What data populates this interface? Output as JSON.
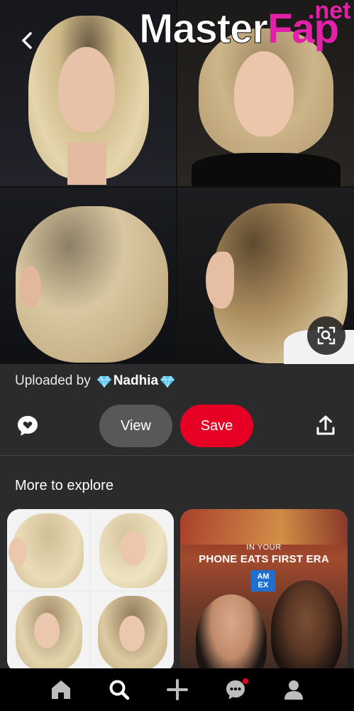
{
  "watermark": {
    "brand_main": "Master",
    "brand_accent": "Fap",
    "brand_tld": ".net"
  },
  "pin": {
    "uploaded_prefix": "Uploaded by",
    "uploader_name": "Nadhia",
    "actions": {
      "view_label": "View",
      "save_label": "Save"
    }
  },
  "explore": {
    "title": "More to explore",
    "ad": {
      "kicker": "IN YOUR",
      "headline": "PHONE EATS FIRST ERA",
      "brand_logo_line1": "AM",
      "brand_logo_line2": "EX"
    }
  },
  "icons": {
    "back": "chevron-left-icon",
    "zoom": "visual-search-icon",
    "comment": "comment-heart-icon",
    "share": "share-icon",
    "nav": [
      "home-icon",
      "search-icon",
      "add-icon",
      "messages-icon",
      "profile-icon"
    ]
  },
  "colors": {
    "save": "#e60023",
    "view": "#585858",
    "watermark_accent": "#e320a8",
    "background": "#2b2b2b"
  }
}
